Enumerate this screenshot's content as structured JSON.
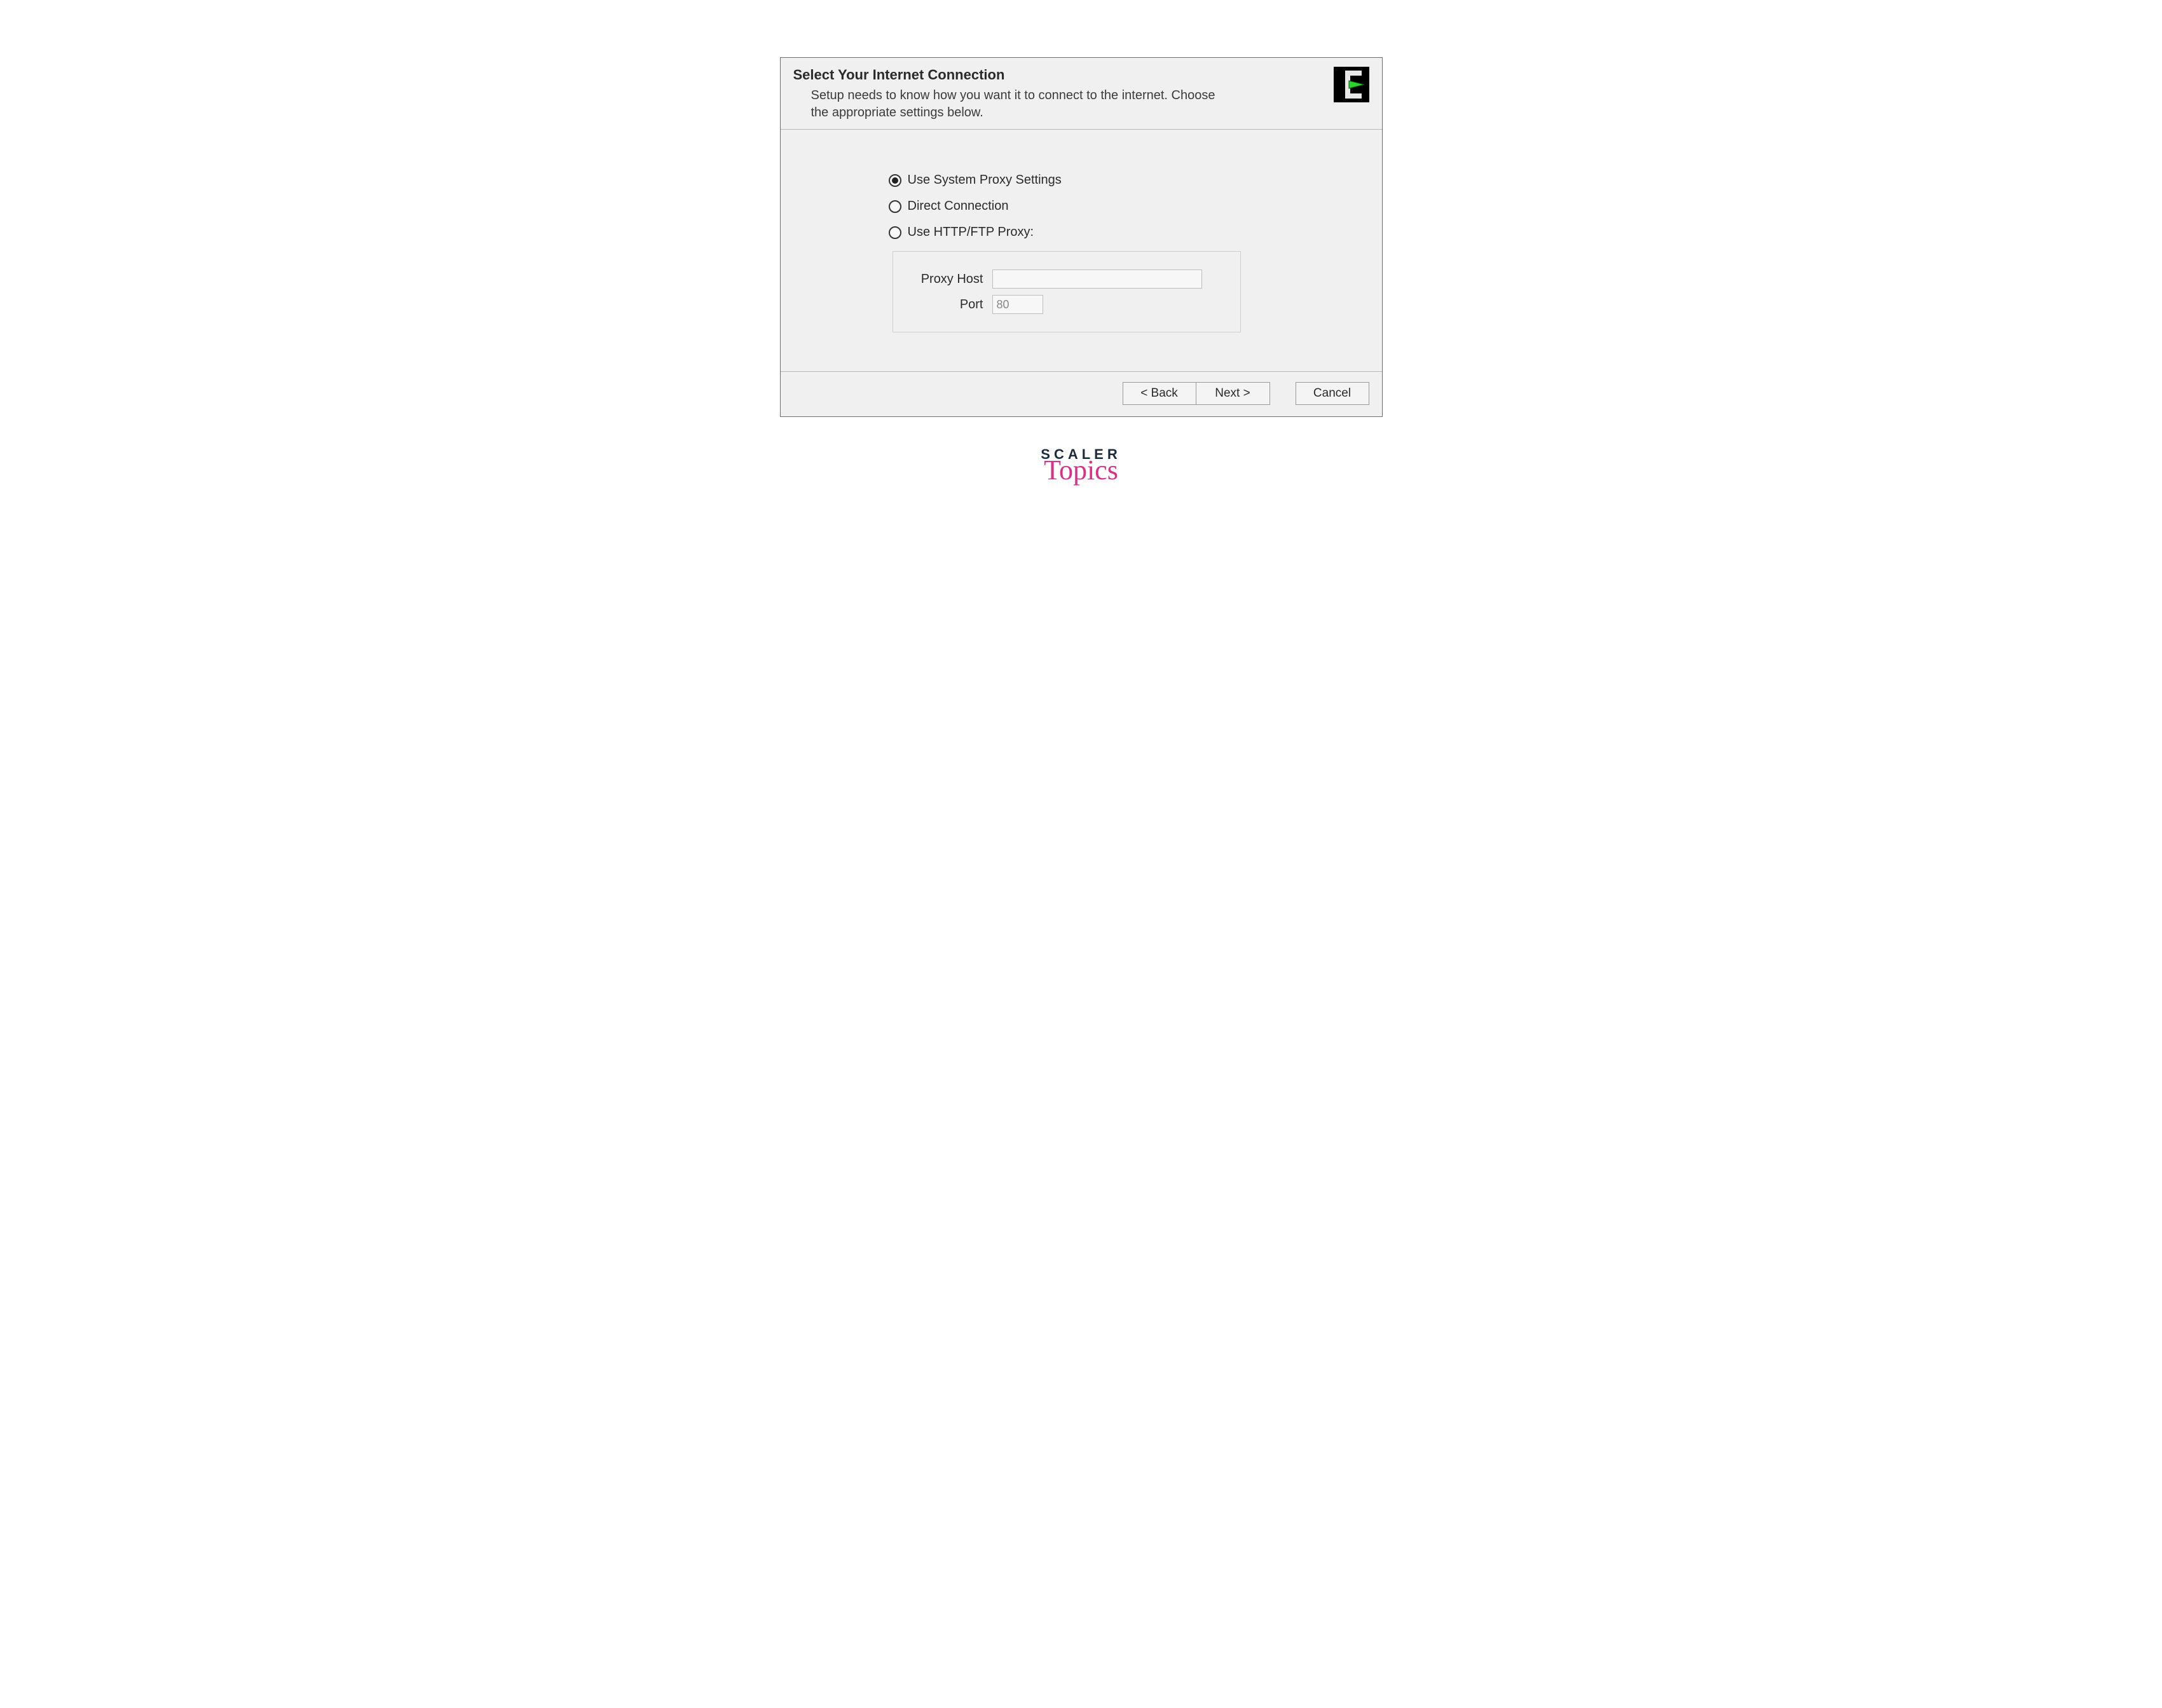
{
  "header": {
    "title": "Select Your Internet Connection",
    "description": "Setup needs to know how you want it to connect to the internet.  Choose the appropriate settings below.",
    "logo_icon": "cygwin-logo"
  },
  "connection": {
    "options": [
      {
        "label": "Use System Proxy Settings",
        "selected": true
      },
      {
        "label": "Direct Connection",
        "selected": false
      },
      {
        "label": "Use HTTP/FTP Proxy:",
        "selected": false
      }
    ],
    "proxy": {
      "host_label": "Proxy Host",
      "host_value": "",
      "port_label": "Port",
      "port_value": "80"
    }
  },
  "footer": {
    "back_label": "< Back",
    "next_label": "Next >",
    "cancel_label": "Cancel"
  },
  "watermark": {
    "line1": "SCALER",
    "line2": "Topics"
  }
}
